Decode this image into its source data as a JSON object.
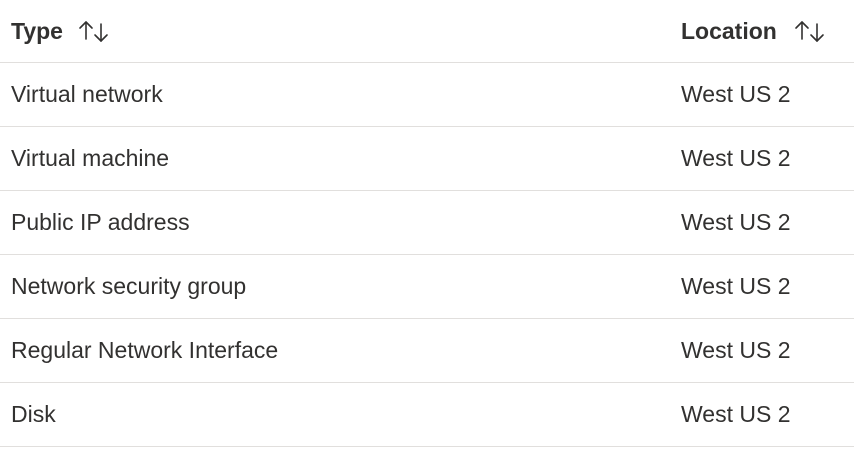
{
  "table": {
    "columns": {
      "type_label": "Type",
      "location_label": "Location",
      "sort_icon": "sort-up-down-icon"
    },
    "rows": [
      {
        "type": "Virtual network",
        "location": "West US 2"
      },
      {
        "type": "Virtual machine",
        "location": "West US 2"
      },
      {
        "type": "Public IP address",
        "location": "West US 2"
      },
      {
        "type": "Network security group",
        "location": "West US 2"
      },
      {
        "type": "Regular Network Interface",
        "location": "West US 2"
      },
      {
        "type": "Disk",
        "location": "West US 2"
      }
    ],
    "colors": {
      "text": "#323130",
      "divider": "#e1dfdd",
      "background": "#ffffff"
    }
  }
}
